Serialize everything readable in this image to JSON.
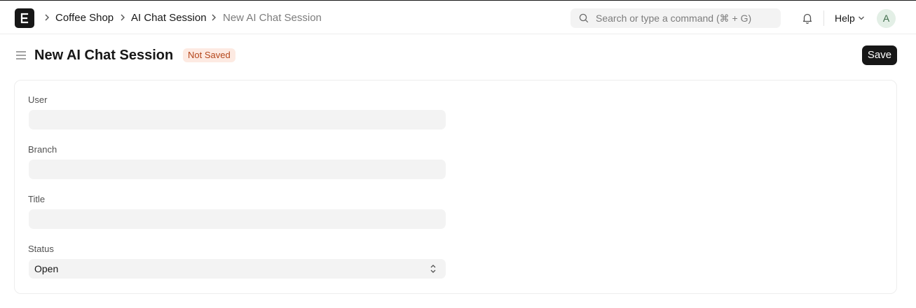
{
  "navbar": {
    "logo_icon": "erpnext-logo-icon",
    "breadcrumbs": [
      {
        "label": "Coffee Shop"
      },
      {
        "label": "AI Chat Session"
      },
      {
        "label": "New AI Chat Session"
      }
    ],
    "search": {
      "placeholder": "Search or type a command (⌘ + G)",
      "icon": "search-icon"
    },
    "notification_icon": "bell-icon",
    "help_label": "Help",
    "avatar_initial": "A"
  },
  "page": {
    "title": "New AI Chat Session",
    "status_badge": "Not Saved",
    "save_label": "Save"
  },
  "form": {
    "fields": [
      {
        "label": "User",
        "value": ""
      },
      {
        "label": "Branch",
        "value": ""
      },
      {
        "label": "Title",
        "value": ""
      },
      {
        "label": "Status",
        "value": "Open"
      }
    ]
  },
  "colors": {
    "primary_button": "#171717",
    "badge_bg": "#fdeae2",
    "badge_text": "#b4461b",
    "input_bg": "#f3f3f3"
  }
}
